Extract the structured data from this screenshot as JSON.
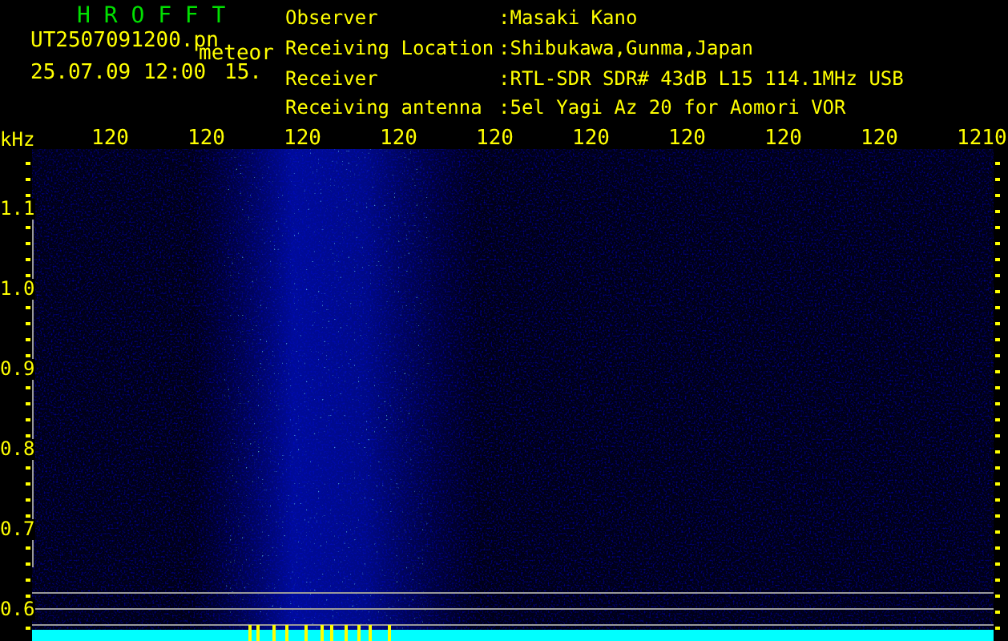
{
  "title": "H R O F F T",
  "file": "UT2507091200.pn",
  "mode": "meteor",
  "datetime": "25.07.09 12:00",
  "count": "15.",
  "info": [
    {
      "label": "Observer",
      "value": ":Masaki Kano"
    },
    {
      "label": "Receiving Location",
      "value": ":Shibukawa,Gunma,Japan"
    },
    {
      "label": "Receiver",
      "value": ":RTL-SDR SDR# 43dB L15 114.1MHz USB"
    },
    {
      "label": "Receiving antenna",
      "value": ":5el Yagi Az 20 for Aomori VOR"
    }
  ],
  "x_axis": {
    "labels": [
      "120",
      "120",
      "120",
      "120",
      "120",
      "120",
      "120",
      "120",
      "120",
      "1210"
    ]
  },
  "y_axis": {
    "unit": "kHz",
    "labels": [
      "1.1",
      "1.0",
      "0.9",
      "0.8",
      "0.7",
      "0.6"
    ]
  }
}
